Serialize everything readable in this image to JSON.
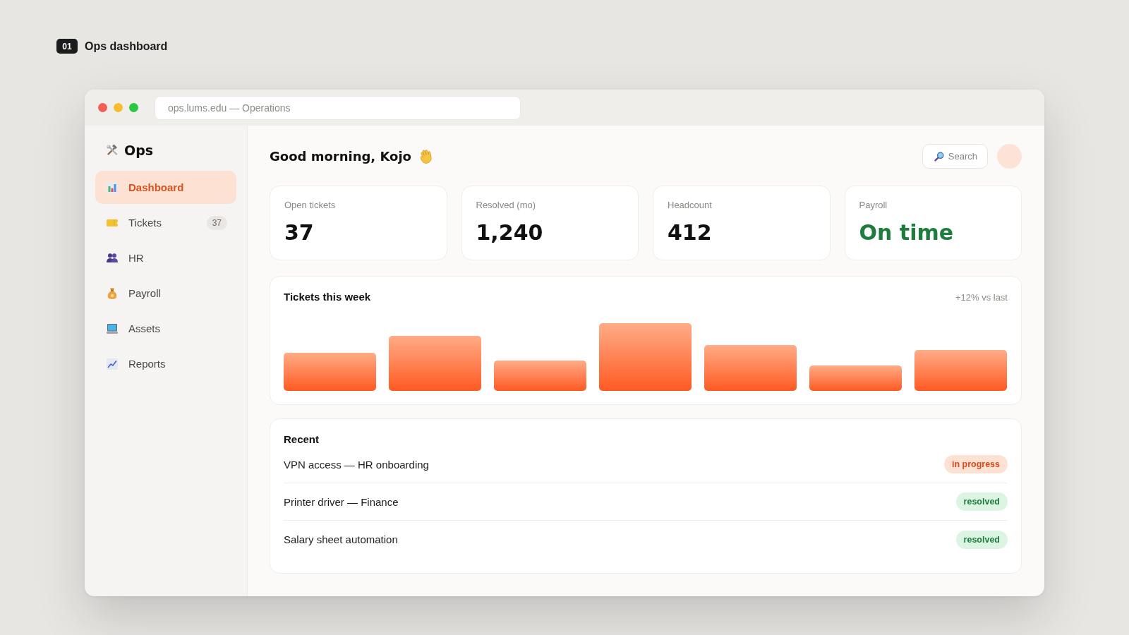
{
  "page_label": {
    "number": "01",
    "title": "Ops dashboard"
  },
  "browser": {
    "address": "ops.lums.edu — Operations"
  },
  "sidebar": {
    "brand": "Ops",
    "items": [
      {
        "label": "Dashboard",
        "selected": true
      },
      {
        "label": "Tickets",
        "selected": false,
        "count": "37"
      },
      {
        "label": "HR",
        "selected": false
      },
      {
        "label": "Payroll",
        "selected": false
      },
      {
        "label": "Assets",
        "selected": false
      },
      {
        "label": "Reports",
        "selected": false
      }
    ]
  },
  "header": {
    "greeting": "Good morning, Kojo",
    "search": {
      "label": "Search"
    }
  },
  "stats": [
    {
      "label": "Open tickets",
      "value": "37",
      "kind": "plain"
    },
    {
      "label": "Resolved (mo)",
      "value": "1,240",
      "kind": "plain"
    },
    {
      "label": "Headcount",
      "value": "412",
      "kind": "plain"
    },
    {
      "label": "Payroll",
      "value": "On time",
      "kind": "positive"
    }
  ],
  "chart_card": {
    "title": "Tickets this week",
    "note": "+12% vs last"
  },
  "recent": {
    "title": "Recent",
    "items": [
      {
        "title": "VPN access — HR onboarding",
        "status": "in progress",
        "kind": "pending"
      },
      {
        "title": "Printer driver — Finance",
        "status": "resolved",
        "kind": "done"
      },
      {
        "title": "Salary sheet automation",
        "status": "resolved",
        "kind": "done"
      }
    ]
  }
}
